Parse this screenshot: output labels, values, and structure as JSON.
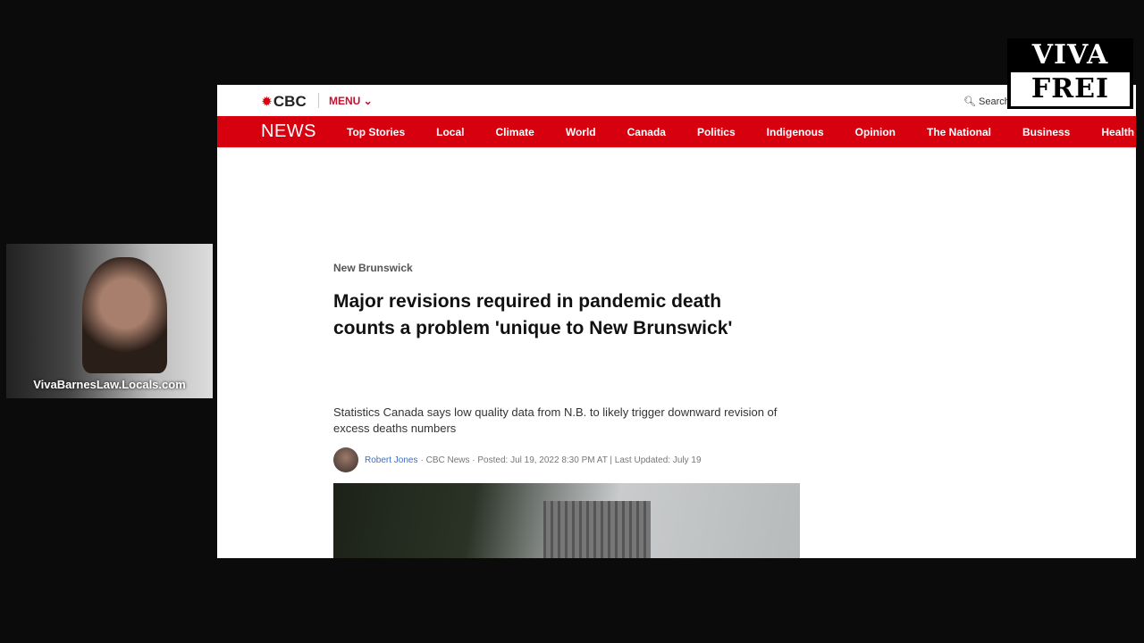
{
  "header": {
    "brand": "CBC",
    "menu": "MENU ⌄",
    "search": "Search"
  },
  "nav": {
    "section": "NEWS",
    "items": [
      "Top Stories",
      "Local",
      "Climate",
      "World",
      "Canada",
      "Politics",
      "Indigenous",
      "Opinion",
      "The National",
      "Business",
      "Health"
    ]
  },
  "article": {
    "section": "New Brunswick",
    "headline": "Major revisions required in pandemic death counts a problem 'unique to New Brunswick'",
    "dek": "Statistics Canada says low quality data from N.B. to likely trigger downward revision of excess deaths numbers",
    "author": "Robert Jones",
    "byline_rest": "· CBC News · Posted: Jul 19, 2022 8:30 PM AT | Last Updated: July 19"
  },
  "overlay": {
    "webcam_label": "VivaBarnesLaw.Locals.com",
    "logo_top": "VIVA",
    "logo_bottom": "FREI"
  },
  "colors": {
    "cbc_red": "#d7000f"
  }
}
